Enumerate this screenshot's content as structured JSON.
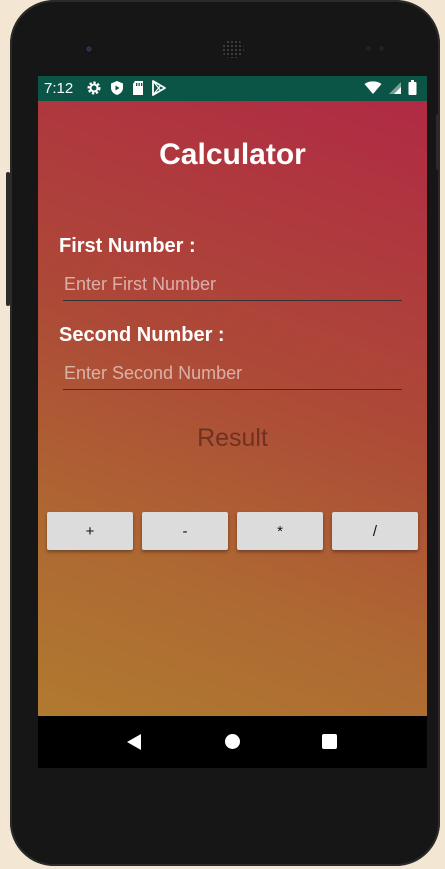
{
  "status_bar": {
    "time": "7:12",
    "left_icons": [
      "gear-icon",
      "shield-play-icon",
      "sd-card-icon",
      "play-store-icon"
    ],
    "right_icons": [
      "wifi-icon",
      "signal-icon",
      "battery-icon"
    ],
    "background": "#0b5547"
  },
  "app": {
    "title": "Calculator",
    "first_label": "First Number :",
    "first_placeholder": "Enter First Number",
    "first_value": "",
    "second_label": "Second Number :",
    "second_placeholder": "Enter Second Number",
    "second_value": "",
    "result": "Result",
    "operators": [
      "+",
      "-",
      "*",
      "/"
    ],
    "colors": {
      "gradient_top": "#b02a44",
      "gradient_bottom": "#b07a30",
      "button": "#dcdcdc",
      "result_text": "#6e3222"
    }
  },
  "nav_bar": {
    "icons": [
      "back-icon",
      "home-icon",
      "recents-icon"
    ]
  }
}
